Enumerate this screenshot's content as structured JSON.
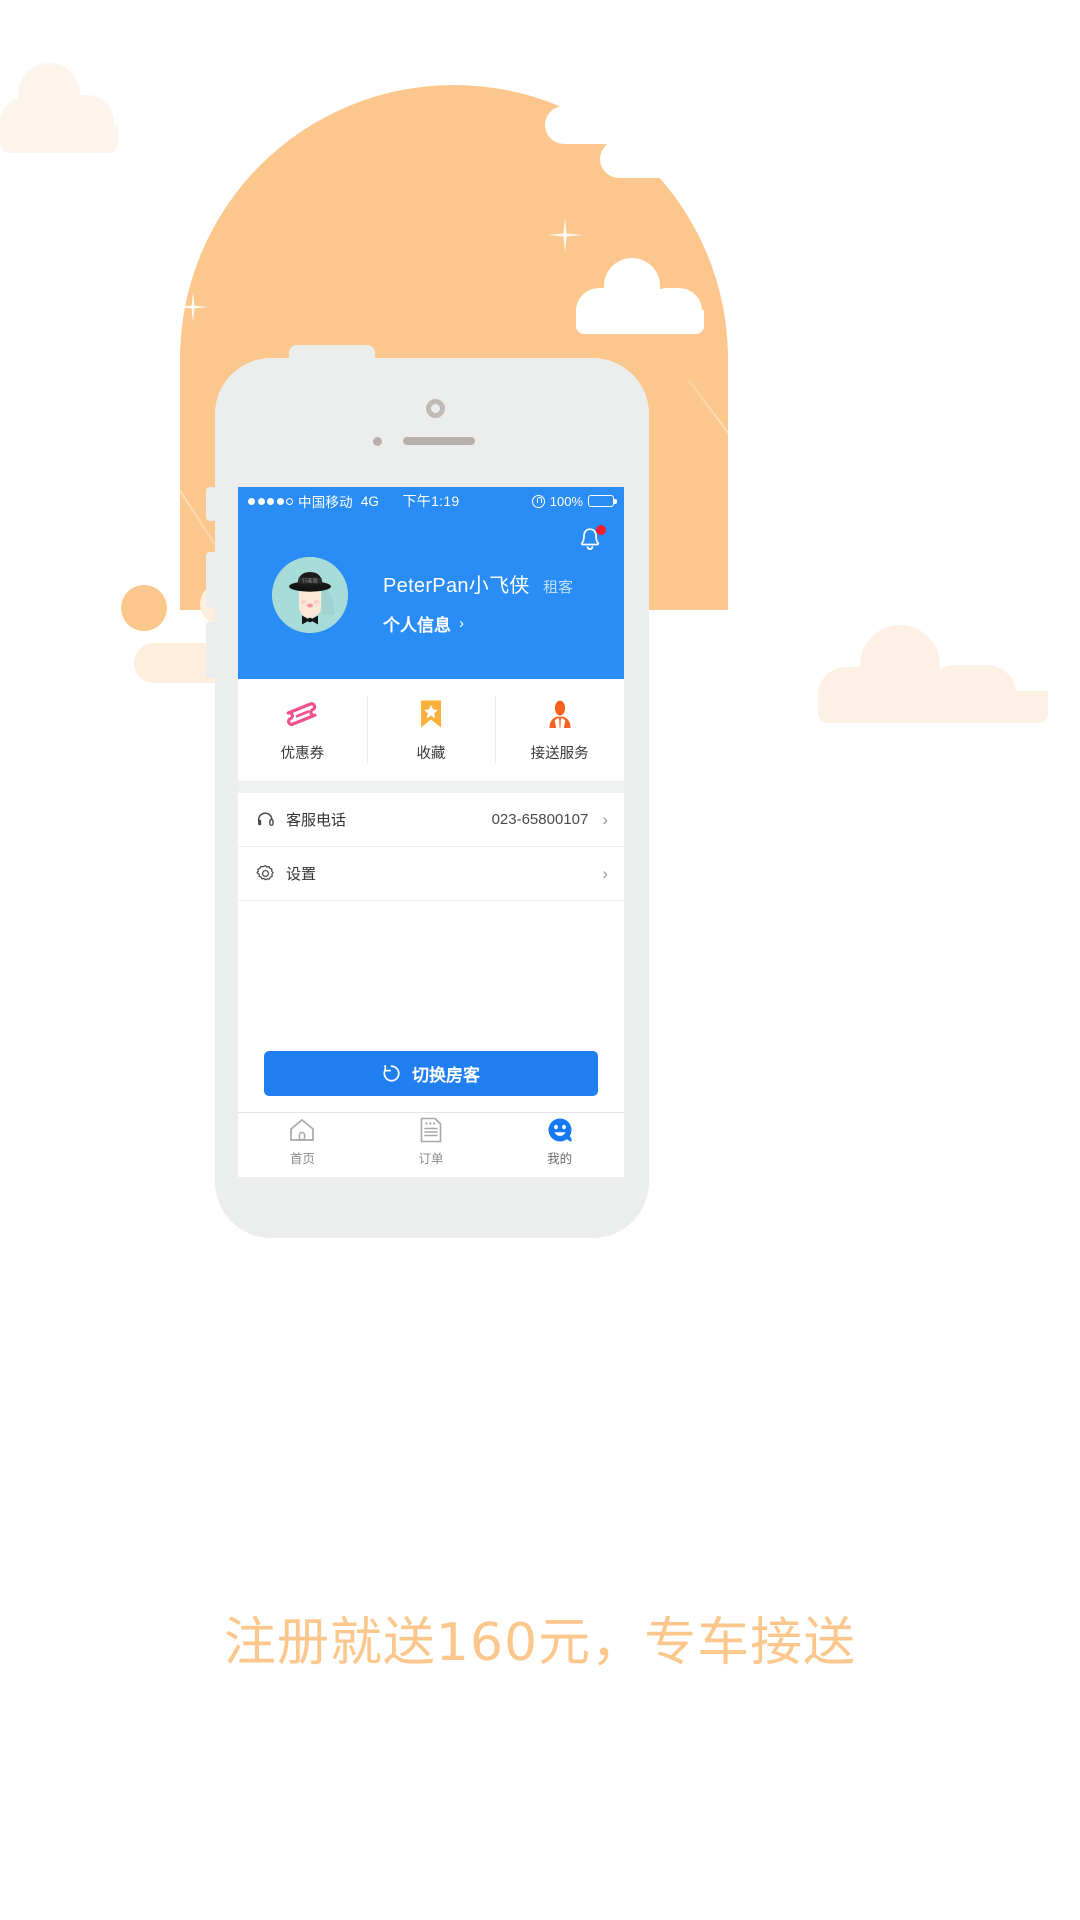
{
  "theme": {
    "accent_blue": "#2a8cf5",
    "button_blue": "#1f7ff0",
    "orange": "#fbc78c",
    "cream": "#fdeede",
    "badge_red": "#fb1b2c"
  },
  "statusbar": {
    "carrier": "中国移动",
    "network": "4G",
    "time": "下午1:19",
    "battery_percent": "100%",
    "signal_dots_filled": 4,
    "signal_dots_total": 5,
    "lock_icon": "rotation-lock-icon"
  },
  "profile": {
    "notification_icon": "bell-icon",
    "has_unread_badge": true,
    "avatar_icon": "user-avatar",
    "name": "PeterPan小飞侠",
    "role": "租客",
    "info_link": "个人信息",
    "info_chevron": "›"
  },
  "quick_actions": [
    {
      "icon": "coupon-ticket-icon",
      "label": "优惠券",
      "color": "#f0508c"
    },
    {
      "icon": "bookmark-star-icon",
      "label": "收藏",
      "color": "#fbb03b"
    },
    {
      "icon": "person-service-icon",
      "label": "接送服务",
      "color": "#f7601e"
    }
  ],
  "list_rows": [
    {
      "icon": "headset-icon",
      "label": "客服电话",
      "value": "023-65800107",
      "chevron": "›"
    },
    {
      "icon": "gear-icon",
      "label": "设置",
      "value": "",
      "chevron": "›"
    }
  ],
  "switch_button": {
    "icon": "refresh-icon",
    "label": "切换房客"
  },
  "tabbar": [
    {
      "icon": "home-icon",
      "label": "首页",
      "active": false
    },
    {
      "icon": "order-document-icon",
      "label": "订单",
      "active": false
    },
    {
      "icon": "smiley-profile-icon",
      "label": "我的",
      "active": true
    }
  ],
  "caption": {
    "text": "注册就送160元，专车接送"
  }
}
